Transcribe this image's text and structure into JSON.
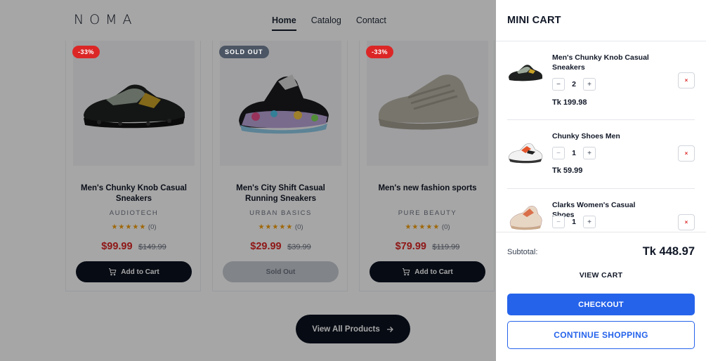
{
  "brand": {
    "logo": "NOMA"
  },
  "nav": {
    "items": [
      "Home",
      "Catalog",
      "Contact"
    ],
    "active": "Home"
  },
  "products": [
    {
      "badge": "-33%",
      "title": "Men's Chunky Knob Casual Sneakers",
      "brand": "AUDIOTECH",
      "stars": "★★★★★",
      "reviews": "(0)",
      "price": "$99.99",
      "old_price": "$149.99",
      "button": "Add to Cart"
    },
    {
      "badge": "SOLD OUT",
      "title": "Men's City Shift Casual Running Sneakers",
      "brand": "URBAN BASICS",
      "stars": "★★★★★",
      "reviews": "(0)",
      "price": "$29.99",
      "old_price": "$39.99",
      "button": "Sold Out"
    },
    {
      "badge": "-33%",
      "title": "Men's new fashion sports",
      "brand": "PURE BEAUTY",
      "stars": "★★★★★",
      "reviews": "(0)",
      "price": "$79.99",
      "old_price": "$119.99",
      "button": "Add to Cart"
    }
  ],
  "view_all": {
    "label": "View All Products"
  },
  "cart": {
    "title": "MINI CART",
    "items": [
      {
        "name": "Men's Chunky Knob Casual Sneakers",
        "qty": "2",
        "price": "Tk 199.98",
        "minus": "−",
        "plus": "+",
        "remove": "×"
      },
      {
        "name": "Chunky Shoes Men",
        "qty": "1",
        "price": "Tk 59.99",
        "minus": "−",
        "plus": "+",
        "remove": "×"
      },
      {
        "name": "Clarks Women's Casual Shoes",
        "qty": "1",
        "price": "",
        "minus": "−",
        "plus": "+",
        "remove": "×"
      }
    ],
    "subtotal_label": "Subtotal:",
    "subtotal_value": "Tk 448.97",
    "view_cart": "VIEW CART",
    "checkout": "CHECKOUT",
    "continue": "CONTINUE SHOPPING"
  },
  "colors": {
    "accent": "#2563eb",
    "sale": "#dc2626",
    "dark": "#0b1220"
  }
}
